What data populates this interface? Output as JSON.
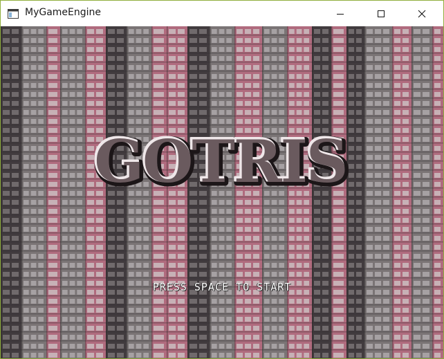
{
  "window": {
    "title": "MyGameEngine",
    "app_icon": "window-app-icon",
    "controls": {
      "minimize": "minimize-icon",
      "maximize": "maximize-icon",
      "close": "close-icon"
    }
  },
  "game": {
    "logo_text": "GOTRIS",
    "prompt": "PRESS SPACE TO START",
    "background": "pink-apartment-highrise-photo",
    "colors": {
      "logo_fill": "#6a5a5e",
      "logo_outline": "#1c1618",
      "logo_highlight": "#efe7e9",
      "prompt_text": "#ffffff",
      "building_pink": "#c97a90",
      "building_dark": "#4a4447",
      "building_gray": "#8b8486"
    }
  }
}
